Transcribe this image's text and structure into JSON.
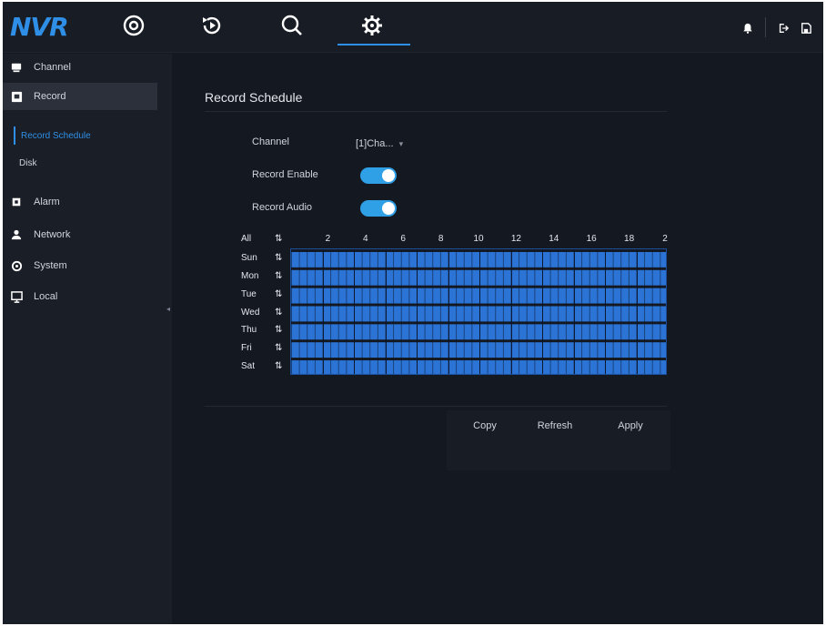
{
  "app": {
    "logo": "NVR"
  },
  "topnav": {
    "items": [
      {
        "name": "live-view",
        "icon": "target-icon"
      },
      {
        "name": "playback",
        "icon": "playback-icon"
      },
      {
        "name": "search",
        "icon": "search-icon"
      },
      {
        "name": "settings",
        "icon": "gear-icon",
        "active": true
      }
    ],
    "right_icons": [
      "bell-icon",
      "logout-icon",
      "save-icon"
    ]
  },
  "sidebar": {
    "items": [
      {
        "label": "Channel",
        "icon": "camera-icon"
      },
      {
        "label": "Record",
        "icon": "record-icon",
        "active": true
      },
      {
        "label": "Alarm",
        "icon": "alarm-icon"
      },
      {
        "label": "Network",
        "icon": "network-icon"
      },
      {
        "label": "System",
        "icon": "system-icon"
      },
      {
        "label": "Local",
        "icon": "monitor-icon"
      }
    ],
    "subitems": [
      {
        "label": "Record Schedule",
        "active": true
      },
      {
        "label": "Disk"
      }
    ]
  },
  "page": {
    "title": "Record Schedule",
    "channel_label": "Channel",
    "channel_value": "[1]Cha...",
    "record_enable_label": "Record Enable",
    "record_enable": true,
    "record_audio_label": "Record Audio",
    "record_audio": true
  },
  "schedule": {
    "all_label": "All",
    "hours": [
      "2",
      "4",
      "6",
      "8",
      "10",
      "12",
      "14",
      "16",
      "18",
      "2"
    ],
    "days": [
      "Sun",
      "Mon",
      "Tue",
      "Wed",
      "Thu",
      "Fri",
      "Sat"
    ]
  },
  "buttons": {
    "copy": "Copy",
    "refresh": "Refresh",
    "apply": "Apply"
  },
  "colors": {
    "accent": "#2f8fe6",
    "grid_fill": "#2b74d6",
    "toggle_on": "#2f9fe6"
  }
}
